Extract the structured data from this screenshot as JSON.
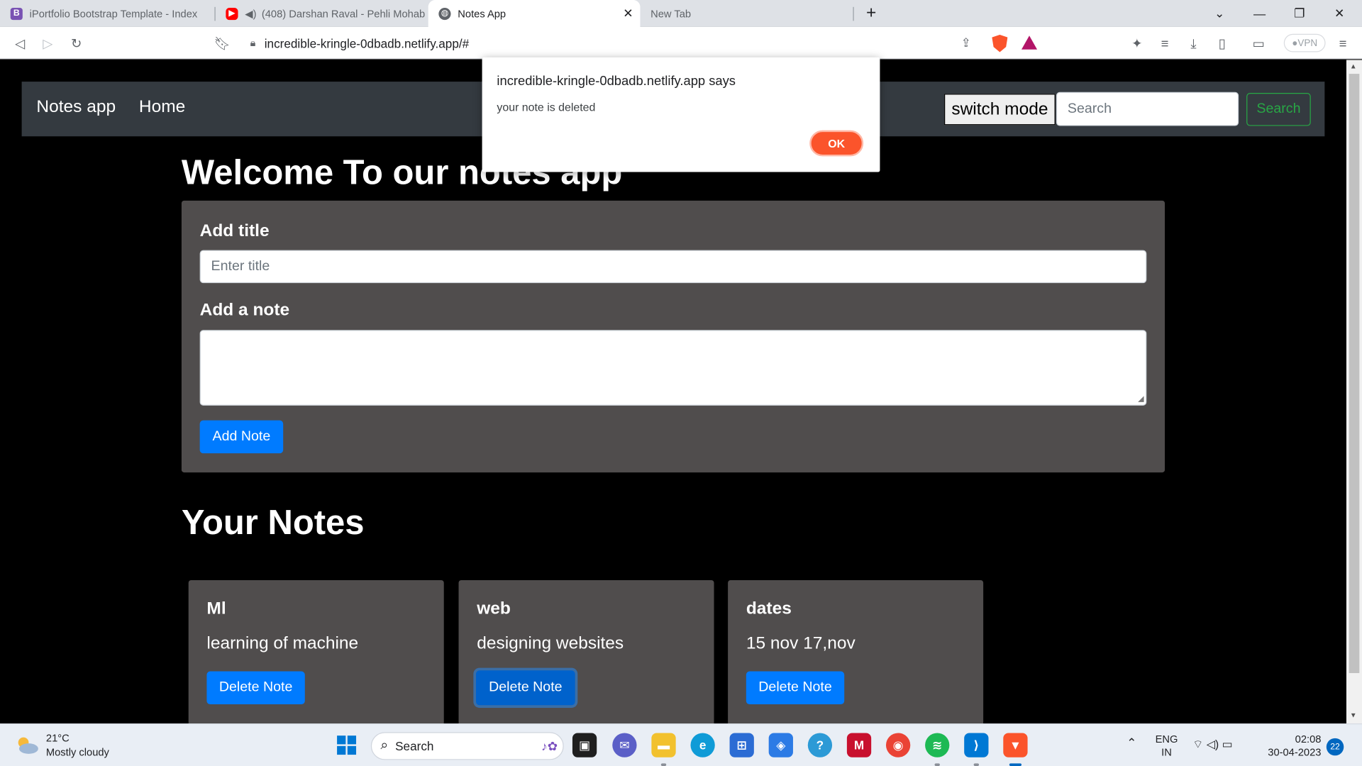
{
  "browser": {
    "tabs": [
      {
        "title": "iPortfolio Bootstrap Template - Index",
        "favicon": "bootstrap-icon",
        "active": false
      },
      {
        "title": "(408) Darshan Raval - Pehli Mohab",
        "favicon": "youtube-icon",
        "active": false
      },
      {
        "title": "Notes App",
        "favicon": "globe-icon",
        "active": true
      },
      {
        "title": "New Tab",
        "favicon": "",
        "active": false
      }
    ],
    "url": "incredible-kringle-0dbadb.netlify.app/#",
    "vpn_label": "VPN"
  },
  "navbar": {
    "brand": "Notes app",
    "home": "Home",
    "switch_mode": "switch mode",
    "search_placeholder": "Search",
    "search_button": "Search"
  },
  "main": {
    "heading": "Welcome To our notes app",
    "title_label": "Add title",
    "title_placeholder": "Enter title",
    "note_label": "Add a note",
    "add_button": "Add Note",
    "notes_heading": "Your Notes"
  },
  "notes": [
    {
      "title": "Ml",
      "text": "learning of machine",
      "button": "Delete Note"
    },
    {
      "title": "web",
      "text": "designing websites",
      "button": "Delete Note"
    },
    {
      "title": "dates",
      "text": "15 nov 17,nov",
      "button": "Delete Note"
    }
  ],
  "alert": {
    "origin": "incredible-kringle-0dbadb.netlify.app says",
    "message": "your note is deleted",
    "ok": "OK"
  },
  "taskbar": {
    "temperature": "21°C",
    "weather": "Mostly cloudy",
    "search": "Search",
    "lang_top": "ENG",
    "lang_bottom": "IN",
    "time": "02:08",
    "date": "30-04-2023",
    "notifications": "22"
  },
  "colors": {
    "accent": "#007bff",
    "navbar": "#343a40",
    "card": "#504d4d",
    "search_green": "#28a745",
    "brave_orange": "#fb542b"
  }
}
